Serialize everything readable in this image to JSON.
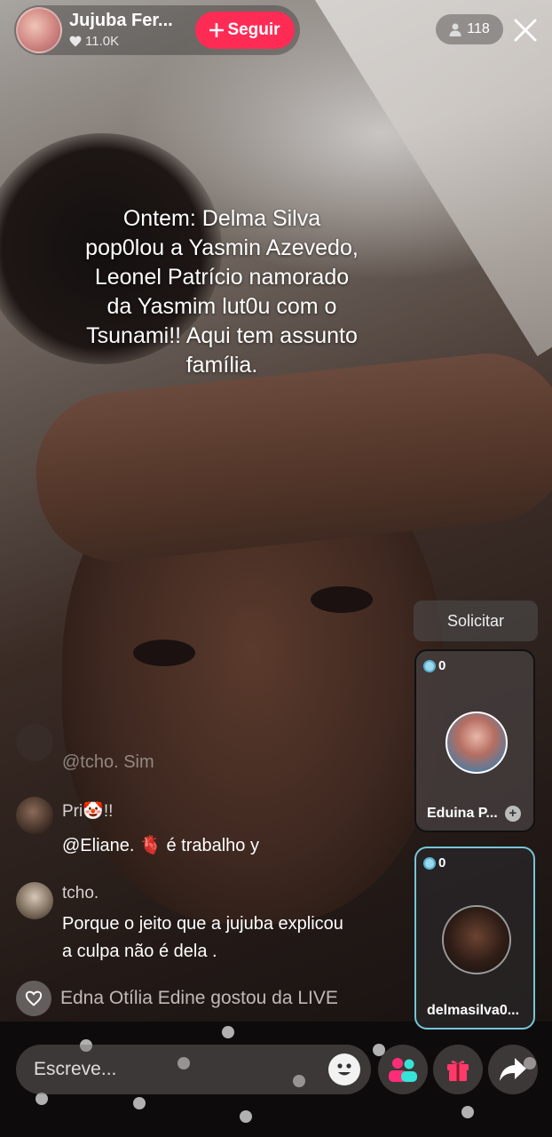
{
  "host": {
    "name": "Jujuba Fer...",
    "likes": "11.0K",
    "follow_label": "Seguir"
  },
  "viewers": {
    "count": "118"
  },
  "caption": {
    "lines": [
      "Ontem: Delma Silva",
      "pop0lou a Yasmin Azevedo,",
      "Leonel Patrício namorado",
      "da Yasmim lut0u com o",
      "Tsunami!! Aqui tem assunto",
      "família."
    ]
  },
  "panel": {
    "request_label": "Solicitar",
    "guests": [
      {
        "coins": "0",
        "name": "Eduina P..."
      },
      {
        "coins": "0",
        "name": "delmasilva0..."
      }
    ]
  },
  "comments": [
    {
      "user": "",
      "text": "@tcho. Sim"
    },
    {
      "user": "Pri🤡!!",
      "text": "@Eliane. 🫀 é trabalho y"
    },
    {
      "user": "tcho.",
      "text_lines": [
        "Porque o jeito que a jujuba explicou",
        "a culpa não é dela ."
      ]
    }
  ],
  "like_notice": "Edna Otília Edine gostou da LIVE",
  "bottom": {
    "input_placeholder": "Escreve..."
  },
  "icons": [
    "heart-icon",
    "plus-icon",
    "person-icon",
    "close-icon",
    "emoji-icon",
    "multi-guest-icon",
    "gift-icon",
    "share-icon"
  ],
  "colors": {
    "follow": "#fe2c55",
    "guest_active_border": "#76c6d6",
    "coin": "#9bd9ee"
  }
}
